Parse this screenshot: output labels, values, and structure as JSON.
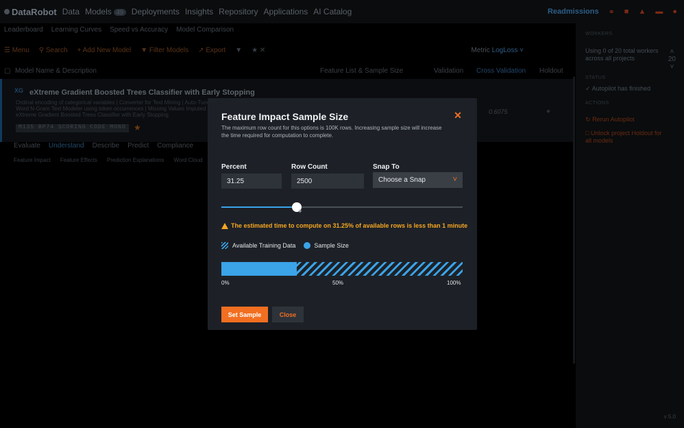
{
  "app": {
    "logo": "DataRobot",
    "nav": [
      {
        "label": "Data"
      },
      {
        "label": "Models",
        "badge": "49"
      },
      {
        "label": "Deployments"
      },
      {
        "label": "Insights"
      },
      {
        "label": "Repository"
      },
      {
        "label": "Applications"
      },
      {
        "label": "AI Catalog"
      }
    ],
    "project_name": "Readmissions",
    "colors": {
      "accent": "#f26f21",
      "blue": "#3ba3e8",
      "modal_bg": "#1d2127",
      "warning": "#f5a623"
    }
  },
  "subtabs": [
    "Leaderboard",
    "Learning Curves",
    "Speed vs Accuracy",
    "Model Comparison"
  ],
  "toolbar": {
    "menu": "Menu",
    "search": "Search",
    "add_model": "+ Add New Model",
    "filter": "Filter Models",
    "export": "Export",
    "metric_label": "Metric",
    "metric_value": "LogLoss"
  },
  "table_header": {
    "name": "Model Name & Description",
    "featurelist": "Feature List & Sample Size",
    "validation": "Validation",
    "cross_validation": "Cross Validation",
    "holdout": "Holdout"
  },
  "model": {
    "title": "eXtreme Gradient Boosted Trees Classifier with Early Stopping",
    "description": "Ordinal encoding of categorical variables | Converter for Text Mining | Auto-Tuned Word N-Gram Text Modeler using token occurrences | Missing Values Imputed | eXtreme Gradient Boosted Trees Classifier with Early Stopping",
    "chip": "M135 BP74 SCORING CODE MONO",
    "cv": "0.6075",
    "tabs": [
      "Evaluate",
      "Understand",
      "Describe",
      "Predict",
      "Compliance"
    ],
    "subtabs": [
      "Feature Impact",
      "Feature Effects",
      "Prediction Explanations",
      "Word Cloud"
    ]
  },
  "right_panel": {
    "workers_heading": "WORKERS",
    "workers_text": "Using 0 of 20 total workers across all projects",
    "workers_count": "20",
    "status_heading": "STATUS",
    "status_text": "Autopilot has finished",
    "actions_heading": "ACTIONS",
    "rerun": "Rerun Autopilot",
    "unlock": "Unlock project Holdout for all models",
    "version": "v 5.0"
  },
  "modal": {
    "title": "Feature Impact Sample Size",
    "description": "The maximum row count for this options is 100K rows. Increasing sample size will increase the time required for computation to complete.",
    "percent_label": "Percent",
    "percent_value": "31.25",
    "row_count_label": "Row Count",
    "row_count_value": "2500",
    "snap_label": "Snap To",
    "snap_placeholder": "Choose a Snap",
    "slider_value_pct": 31.25,
    "warning": "The estimated time to compute on 31.25% of available rows is less than 1 minute",
    "legend_available": "Available Training Data",
    "legend_sample": "Sample Size",
    "ticks": [
      "0%",
      "50%",
      "100%"
    ],
    "set_button": "Set Sample",
    "close_button": "Close"
  }
}
